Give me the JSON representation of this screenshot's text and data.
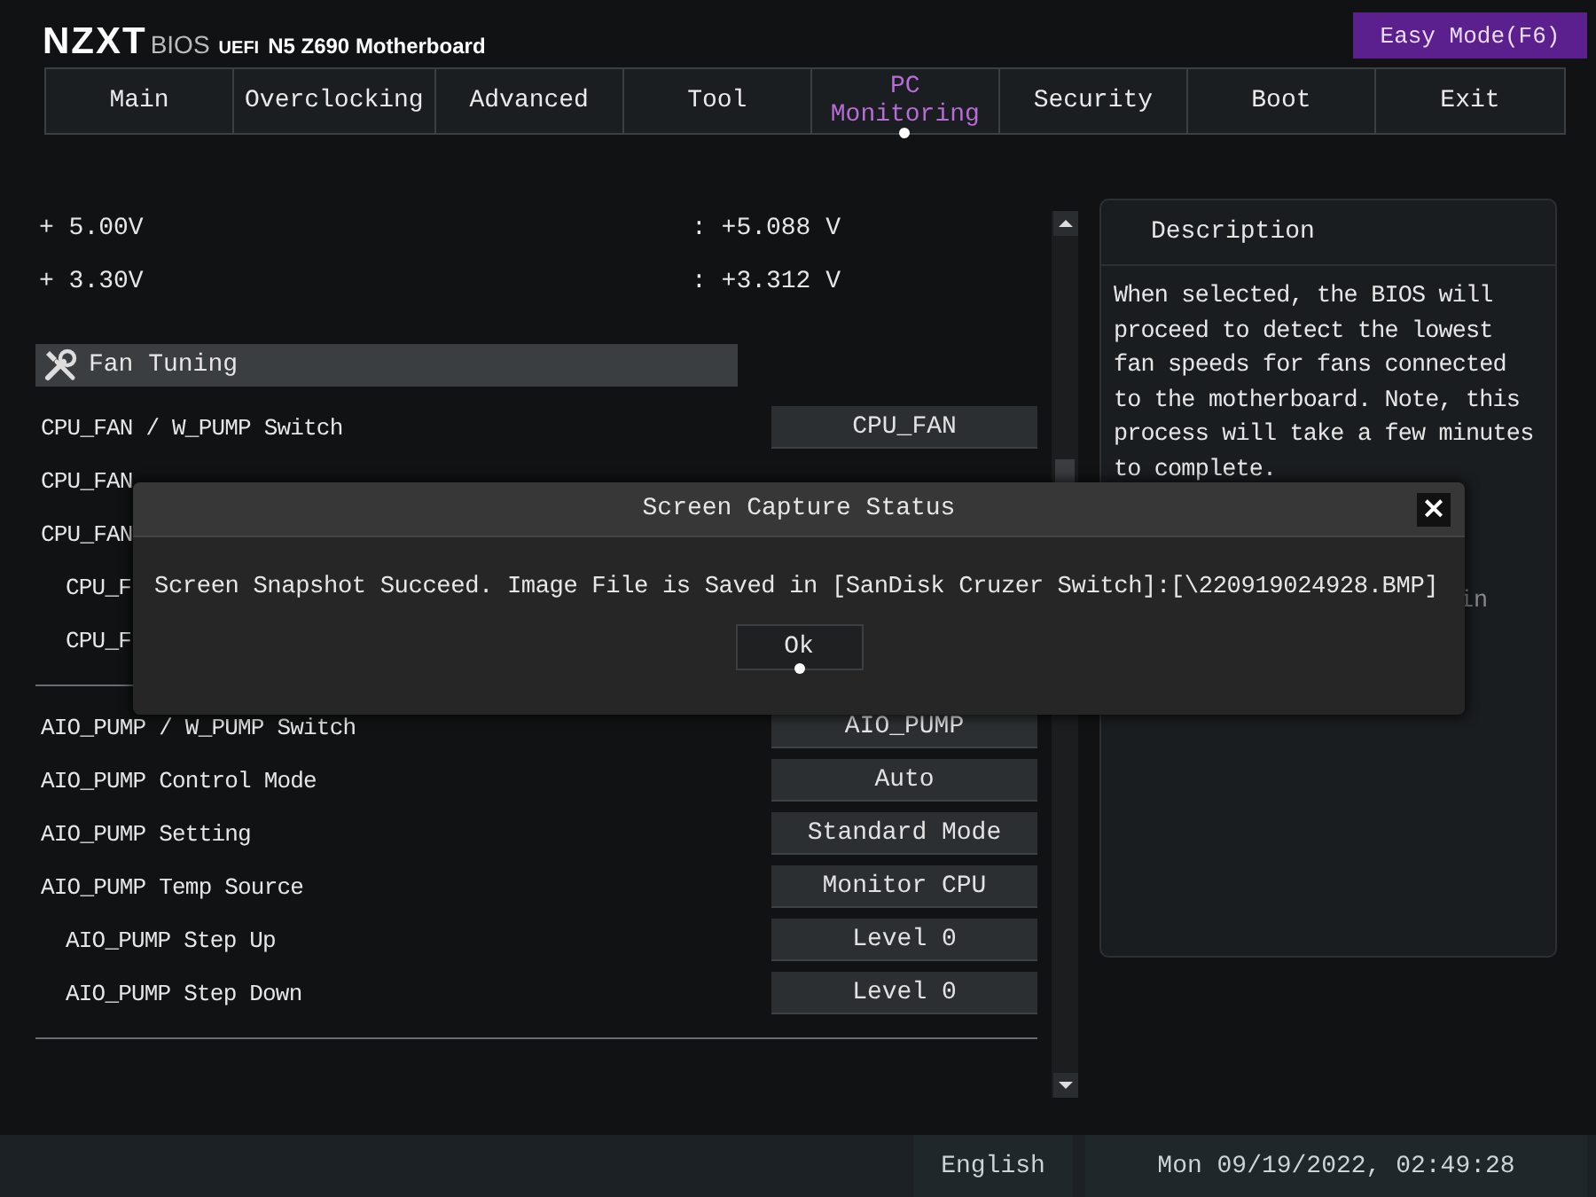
{
  "header": {
    "logo": "NZXT",
    "bios": "BIOS",
    "uefi": "UEFI",
    "model": "N5 Z690 Motherboard",
    "easy_mode": "Easy Mode(F6)"
  },
  "tabs": [
    {
      "label": "Main",
      "selected": false
    },
    {
      "label": "Overclocking",
      "selected": false
    },
    {
      "label": "Advanced",
      "selected": false
    },
    {
      "label": "Tool",
      "selected": false
    },
    {
      "label": "PC Monitoring",
      "selected": true
    },
    {
      "label": "Security",
      "selected": false
    },
    {
      "label": "Boot",
      "selected": false
    },
    {
      "label": "Exit",
      "selected": false
    }
  ],
  "voltages": [
    {
      "label": "+ 5.00V",
      "value": ": +5.088 V"
    },
    {
      "label": "+ 3.30V",
      "value": ": +3.312 V"
    }
  ],
  "section": {
    "title": "Fan Tuning"
  },
  "groups": [
    [
      {
        "label": "CPU_FAN / W_PUMP Switch",
        "value": "CPU_FAN"
      },
      {
        "label": "CPU_FAN"
      },
      {
        "label": "CPU_FAN",
        "children": [
          {
            "label": "CPU_F"
          },
          {
            "label": "CPU_F"
          }
        ]
      }
    ],
    [
      {
        "label": "AIO_PUMP / W_PUMP Switch",
        "value": "AIO_PUMP"
      },
      {
        "label": "AIO_PUMP Control Mode",
        "value": "Auto"
      },
      {
        "label": "AIO_PUMP Setting",
        "value": "Standard Mode"
      },
      {
        "label": "AIO_PUMP Temp Source",
        "value": "Monitor CPU",
        "children": [
          {
            "label": "AIO_PUMP Step Up",
            "value": "Level 0"
          },
          {
            "label": "AIO_PUMP Step Down",
            "value": "Level 0"
          }
        ]
      }
    ]
  ],
  "description": {
    "title": "Description",
    "text": "When selected, the BIOS will proceed to detect the lowest fan speeds for fans connected to the motherboard. Note, this process will take a few minutes to complete.",
    "note_fragment": "in"
  },
  "dialog": {
    "title": "Screen Capture Status",
    "close": "×",
    "message": "Screen Snapshot Succeed. Image File is Saved in  [SanDisk Cruzer Switch]:[\\220919024928.BMP]",
    "button": "Ok"
  },
  "status_bar": {
    "language": "English",
    "datetime": "Mon 09/19/2022, 02:49:28"
  }
}
